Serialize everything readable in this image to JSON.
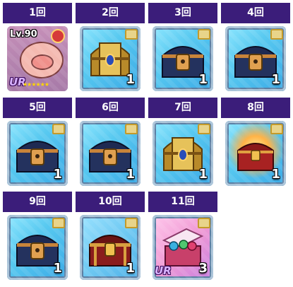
{
  "cells": [
    {
      "label": "1回",
      "count": "",
      "kind": "character",
      "level": "Lv.90",
      "rarity": "UR",
      "stars": "★★★★★★"
    },
    {
      "label": "2回",
      "count": "1",
      "kind": "gold-chest"
    },
    {
      "label": "3回",
      "count": "1",
      "kind": "navy-chest"
    },
    {
      "label": "4回",
      "count": "1",
      "kind": "navy-chest"
    },
    {
      "label": "5回",
      "count": "1",
      "kind": "navy-chest"
    },
    {
      "label": "6回",
      "count": "1",
      "kind": "navy-chest"
    },
    {
      "label": "7回",
      "count": "1",
      "kind": "gold-chest"
    },
    {
      "label": "8回",
      "count": "1",
      "kind": "fire-chest"
    },
    {
      "label": "9回",
      "count": "1",
      "kind": "navy-chest"
    },
    {
      "label": "10回",
      "count": "1",
      "kind": "red-chest"
    },
    {
      "label": "11回",
      "count": "3",
      "kind": "treasure-box",
      "rarity": "UR"
    }
  ],
  "colors": {
    "header": "#3b1d7a",
    "frame": "#58c9f0"
  }
}
